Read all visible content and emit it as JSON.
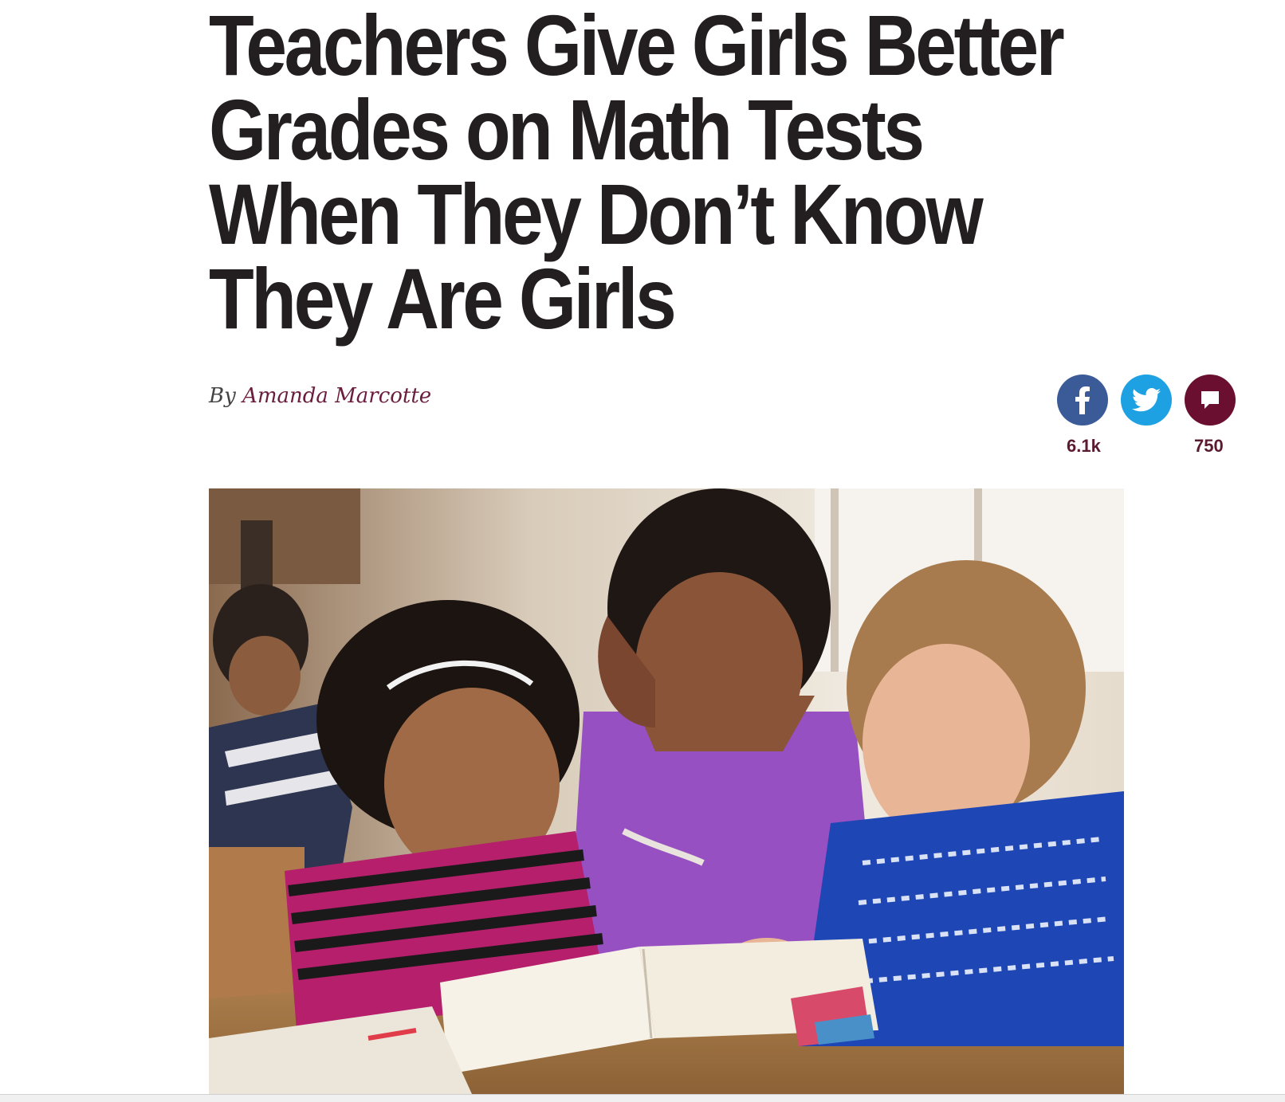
{
  "article": {
    "headline_lines": [
      "Teachers Give Girls Better",
      "Grades on Math Tests",
      "When They Don’t Know",
      "They Are Girls"
    ],
    "byline_prefix": "By",
    "author": "Amanda Marcotte"
  },
  "share": {
    "facebook": {
      "icon": "facebook-icon",
      "count": "6.1k",
      "color": "#3b5b98"
    },
    "twitter": {
      "icon": "twitter-icon",
      "color": "#1da1e3"
    },
    "comments": {
      "icon": "comment-icon",
      "count": "750",
      "color": "#6b0f30"
    }
  },
  "photo": {
    "subject": "three-girls-reading-book-in-classroom"
  }
}
